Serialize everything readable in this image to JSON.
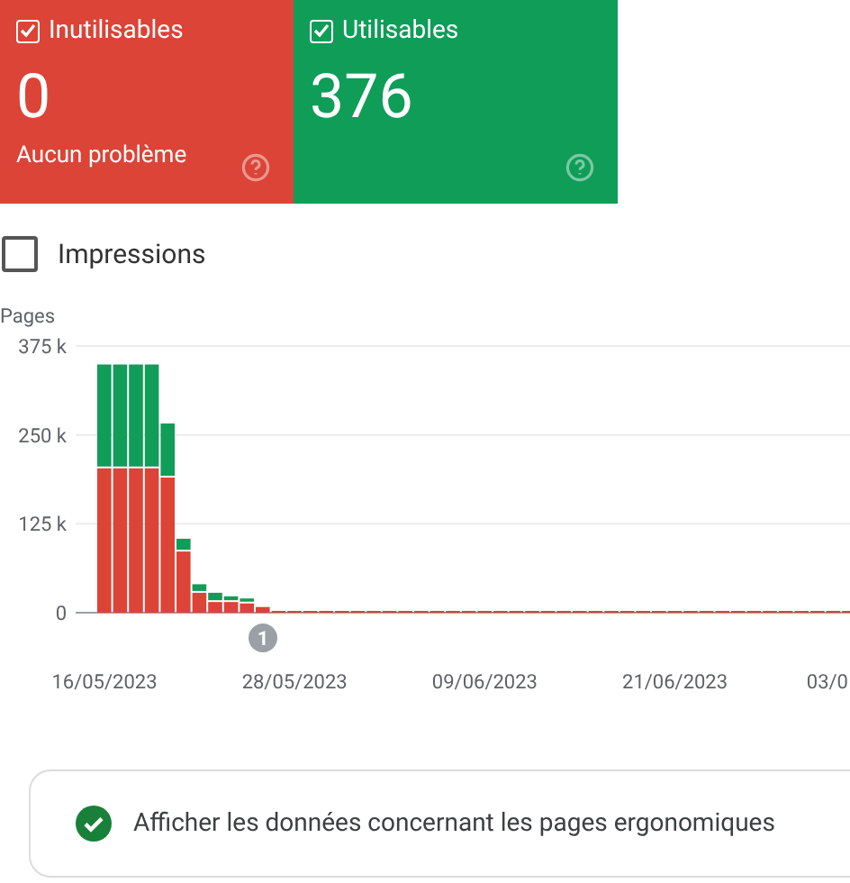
{
  "cards": [
    {
      "label": "Inutilisables",
      "checked": true,
      "value": "0",
      "note": "Aucun problème",
      "color": "#db4437"
    },
    {
      "label": "Utilisables",
      "checked": true,
      "value": "376",
      "color": "#0f9d58"
    }
  ],
  "impressions": {
    "label": "Impressions",
    "checked": false
  },
  "chart": {
    "chart_data": {
      "type": "bar",
      "stacked": true,
      "ylabel": "Pages",
      "categories": [
        "16/05/2023",
        null,
        null,
        null,
        null,
        null,
        null,
        null,
        null,
        null,
        null,
        null,
        "28/05/2023",
        null,
        null,
        null,
        null,
        null,
        null,
        null,
        null,
        null,
        null,
        null,
        "09/06/2023",
        null,
        null,
        null,
        null,
        null,
        null,
        null,
        null,
        null,
        null,
        null,
        "21/06/2023",
        null,
        null,
        null,
        null,
        null,
        null,
        null,
        null,
        null,
        null,
        null,
        "03/0"
      ],
      "ylim": [
        0,
        375
      ],
      "yticks": [
        {
          "value": 0,
          "label": "0"
        },
        {
          "value": 125,
          "label": "125 k"
        },
        {
          "value": 250,
          "label": "250 k"
        },
        {
          "value": 375,
          "label": "375 k"
        }
      ],
      "series": [
        {
          "color": "#db4437",
          "values": [
            203,
            203,
            203,
            203,
            190,
            86,
            28,
            15,
            15,
            13,
            8,
            1,
            1,
            1,
            1,
            1,
            1,
            1,
            1,
            1,
            1,
            1,
            1,
            1,
            1,
            1,
            1,
            1,
            1,
            1,
            1,
            1,
            1,
            1,
            1,
            1,
            1,
            1,
            1,
            1,
            1,
            1,
            1,
            1,
            1,
            1,
            1,
            1,
            null
          ]
        },
        {
          "color": "#0f9d58",
          "values": [
            146,
            146,
            146,
            146,
            76,
            18,
            12,
            13,
            8,
            7,
            0,
            0,
            0,
            0,
            0,
            0,
            0,
            0,
            0,
            0,
            0,
            0,
            0,
            0,
            0,
            0,
            0,
            0,
            0,
            0,
            0,
            0,
            0,
            0,
            0,
            0,
            0,
            0,
            0,
            0,
            0,
            0,
            0,
            0,
            0,
            0,
            0,
            0,
            null
          ]
        }
      ],
      "annotations": [
        "1"
      ]
    }
  },
  "notice": {
    "text": "Afficher les données concernant les pages ergonomiques",
    "done": true
  }
}
